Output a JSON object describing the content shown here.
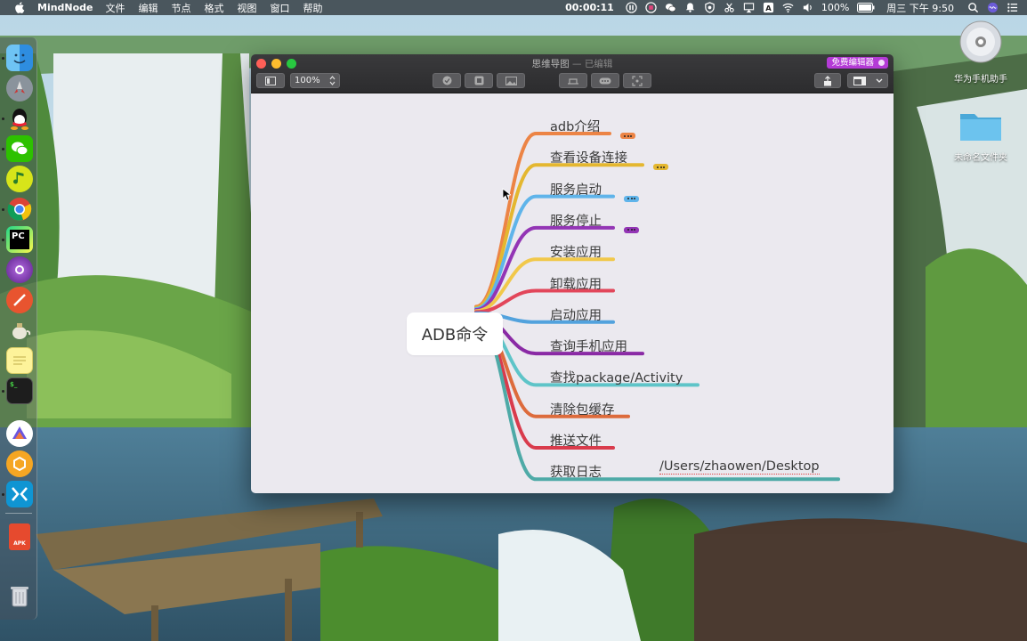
{
  "menubar": {
    "app_name": "MindNode",
    "menus": [
      "文件",
      "编辑",
      "节点",
      "格式",
      "视图",
      "窗口",
      "帮助"
    ],
    "timer": "00:00:11",
    "battery": "100%",
    "clock": "周三 下午 9:50"
  },
  "desktop": {
    "icons": [
      {
        "label": "华为手机助手",
        "icon": "disc-icon"
      },
      {
        "label": "未命名文件夹",
        "icon": "folder-icon"
      }
    ]
  },
  "dock": {
    "apps": [
      "finder-icon",
      "launchpad-icon",
      "qq-icon",
      "wechat-icon",
      "music-icon",
      "chrome-icon",
      "pycharm-icon",
      "app-icon",
      "safari-icon",
      "teapot-icon",
      "notes-icon",
      "terminal-icon",
      "app2-icon",
      "app3-icon",
      "app4-icon",
      "apk-icon",
      "trash-icon"
    ],
    "pc_label": "PC",
    "apk_label": "APK"
  },
  "window": {
    "title": "思维导图",
    "title_state": "— 已编辑",
    "free_badge": "免费编辑器",
    "zoom": "100%",
    "colors": {
      "close": "#ff5f57",
      "minimize": "#febc2e",
      "maximize": "#28c840"
    }
  },
  "mindmap": {
    "root": "ADB命令",
    "branches": [
      {
        "label": "adb介绍",
        "color": "#ec8445",
        "note": true
      },
      {
        "label": "查看设备连接",
        "color": "#e4b730",
        "note": true
      },
      {
        "label": "服务启动",
        "color": "#5fb4ea",
        "note": true
      },
      {
        "label": "服务停止",
        "color": "#9335b5",
        "note": true
      },
      {
        "label": "安装应用",
        "color": "#f1c84a",
        "note": false
      },
      {
        "label": "卸载应用",
        "color": "#e2465a",
        "note": false
      },
      {
        "label": "启动应用",
        "color": "#52a2dd",
        "note": false
      },
      {
        "label": "查询手机应用",
        "color": "#8a2aa5",
        "note": false
      },
      {
        "label": "查找package/Activity",
        "color": "#5ec4c8",
        "note": false
      },
      {
        "label": "清除包缓存",
        "color": "#dd6b3c",
        "note": false
      },
      {
        "label": "推送文件",
        "color": "#d93b4c",
        "note": false
      },
      {
        "label": "获取日志",
        "color": "#4eaaa7",
        "note": false
      }
    ],
    "path_note": "/Users/zhaowen/Desktop"
  }
}
